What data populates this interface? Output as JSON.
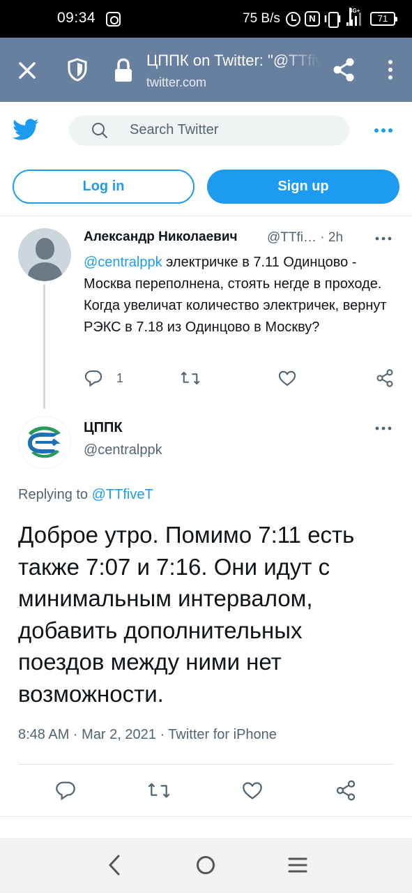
{
  "status_bar": {
    "time": "09:34",
    "net_speed": "75 B/s",
    "network_type": "4G+",
    "battery": "71"
  },
  "browser": {
    "title": "ЦППК on Twitter: \"@TTfiveT",
    "url": "twitter.com",
    "toolbar_bg": "#67809f"
  },
  "header": {
    "search_placeholder": "Search Twitter",
    "login_label": "Log in",
    "signup_label": "Sign up",
    "accent": "#1d9bf0"
  },
  "parent_tweet": {
    "author_name": "Александр Николаевич",
    "author_handle": "@TTfi…",
    "time_sep": "·",
    "time": "2h",
    "mention": "@centralppk",
    "text": " электричке в  7.11 Одинцово - Москва переполнена, стоять негде в проходе. Когда увеличат количество электричек, вернут РЭКС в 7.18 из Одинцово в Москву?",
    "reply_count": "1"
  },
  "main_tweet": {
    "author_name": "ЦППК",
    "author_handle": "@centralppk",
    "replying_prefix": "Replying to ",
    "replying_to": "@TTfiveT",
    "text": "Доброе утро. Помимо 7:11 есть также 7:07 и 7:16. Они идут с минимальным интервалом, добавить дополнительных поездов между ними нет возможности.",
    "meta": "8:48 AM · Mar 2, 2021 · Twitter for iPhone"
  }
}
